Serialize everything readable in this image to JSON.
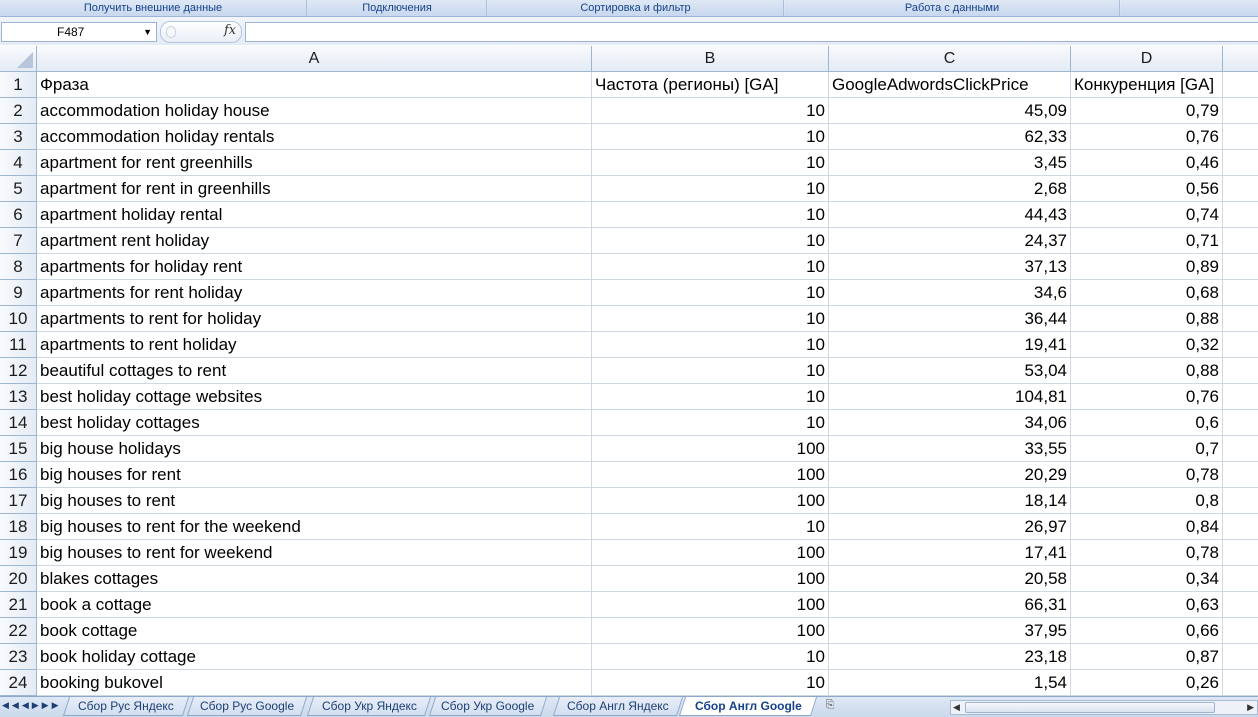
{
  "ribbon": {
    "groups": [
      "Получить внешние данные",
      "Подключения",
      "Сортировка и фильтр",
      "Работа с данными",
      ""
    ]
  },
  "formula_bar": {
    "name_box": "F487",
    "fx_label": "fx",
    "formula": ""
  },
  "columns": [
    "A",
    "B",
    "C",
    "D"
  ],
  "header_row": {
    "row_number": "1",
    "a": "Фраза",
    "b": "Частота (регионы) [GA]",
    "c": "GoogleAdwordsClickPrice",
    "d": "Конкуренция [GA]"
  },
  "rows": [
    {
      "n": "2",
      "a": "accommodation holiday house",
      "b": "10",
      "c": "45,09",
      "d": "0,79"
    },
    {
      "n": "3",
      "a": "accommodation holiday rentals",
      "b": "10",
      "c": "62,33",
      "d": "0,76"
    },
    {
      "n": "4",
      "a": "apartment for rent greenhills",
      "b": "10",
      "c": "3,45",
      "d": "0,46"
    },
    {
      "n": "5",
      "a": "apartment for rent in greenhills",
      "b": "10",
      "c": "2,68",
      "d": "0,56"
    },
    {
      "n": "6",
      "a": "apartment holiday rental",
      "b": "10",
      "c": "44,43",
      "d": "0,74"
    },
    {
      "n": "7",
      "a": "apartment rent holiday",
      "b": "10",
      "c": "24,37",
      "d": "0,71"
    },
    {
      "n": "8",
      "a": "apartments for holiday rent",
      "b": "10",
      "c": "37,13",
      "d": "0,89"
    },
    {
      "n": "9",
      "a": "apartments for rent holiday",
      "b": "10",
      "c": "34,6",
      "d": "0,68"
    },
    {
      "n": "10",
      "a": "apartments to rent for holiday",
      "b": "10",
      "c": "36,44",
      "d": "0,88"
    },
    {
      "n": "11",
      "a": "apartments to rent holiday",
      "b": "10",
      "c": "19,41",
      "d": "0,32"
    },
    {
      "n": "12",
      "a": "beautiful cottages to rent",
      "b": "10",
      "c": "53,04",
      "d": "0,88"
    },
    {
      "n": "13",
      "a": "best holiday cottage websites",
      "b": "10",
      "c": "104,81",
      "d": "0,76"
    },
    {
      "n": "14",
      "a": "best holiday cottages",
      "b": "10",
      "c": "34,06",
      "d": "0,6"
    },
    {
      "n": "15",
      "a": "big house holidays",
      "b": "100",
      "c": "33,55",
      "d": "0,7"
    },
    {
      "n": "16",
      "a": "big houses for rent",
      "b": "100",
      "c": "20,29",
      "d": "0,78"
    },
    {
      "n": "17",
      "a": "big houses to rent",
      "b": "100",
      "c": "18,14",
      "d": "0,8"
    },
    {
      "n": "18",
      "a": "big houses to rent for the weekend",
      "b": "10",
      "c": "26,97",
      "d": "0,84"
    },
    {
      "n": "19",
      "a": "big houses to rent for weekend",
      "b": "100",
      "c": "17,41",
      "d": "0,78"
    },
    {
      "n": "20",
      "a": "blakes cottages",
      "b": "100",
      "c": "20,58",
      "d": "0,34"
    },
    {
      "n": "21",
      "a": "book a cottage",
      "b": "100",
      "c": "66,31",
      "d": "0,63"
    },
    {
      "n": "22",
      "a": "book cottage",
      "b": "100",
      "c": "37,95",
      "d": "0,66"
    },
    {
      "n": "23",
      "a": "book holiday cottage",
      "b": "10",
      "c": "23,18",
      "d": "0,87"
    },
    {
      "n": "24",
      "a": "booking bukovel",
      "b": "10",
      "c": "1,54",
      "d": "0,26"
    }
  ],
  "sheet_tabs": [
    {
      "label": "Сбор Рус Яндекс",
      "active": false
    },
    {
      "label": "Сбор Рус Google",
      "active": false
    },
    {
      "label": "Сбор Укр Яндекс",
      "active": false
    },
    {
      "label": "Сбор Укр Google",
      "active": false
    },
    {
      "label": "Сбор Англ Яндекс",
      "active": false
    },
    {
      "label": "Сбор Англ Google",
      "active": true
    }
  ],
  "icons": {
    "tab_nav": "tab-navigation-arrows",
    "new_sheet": "insert-sheet-icon"
  },
  "colors": {
    "header_bg": "#e4ebf5",
    "grid_line": "#d0d7e5",
    "tab_text": "#15428b"
  }
}
